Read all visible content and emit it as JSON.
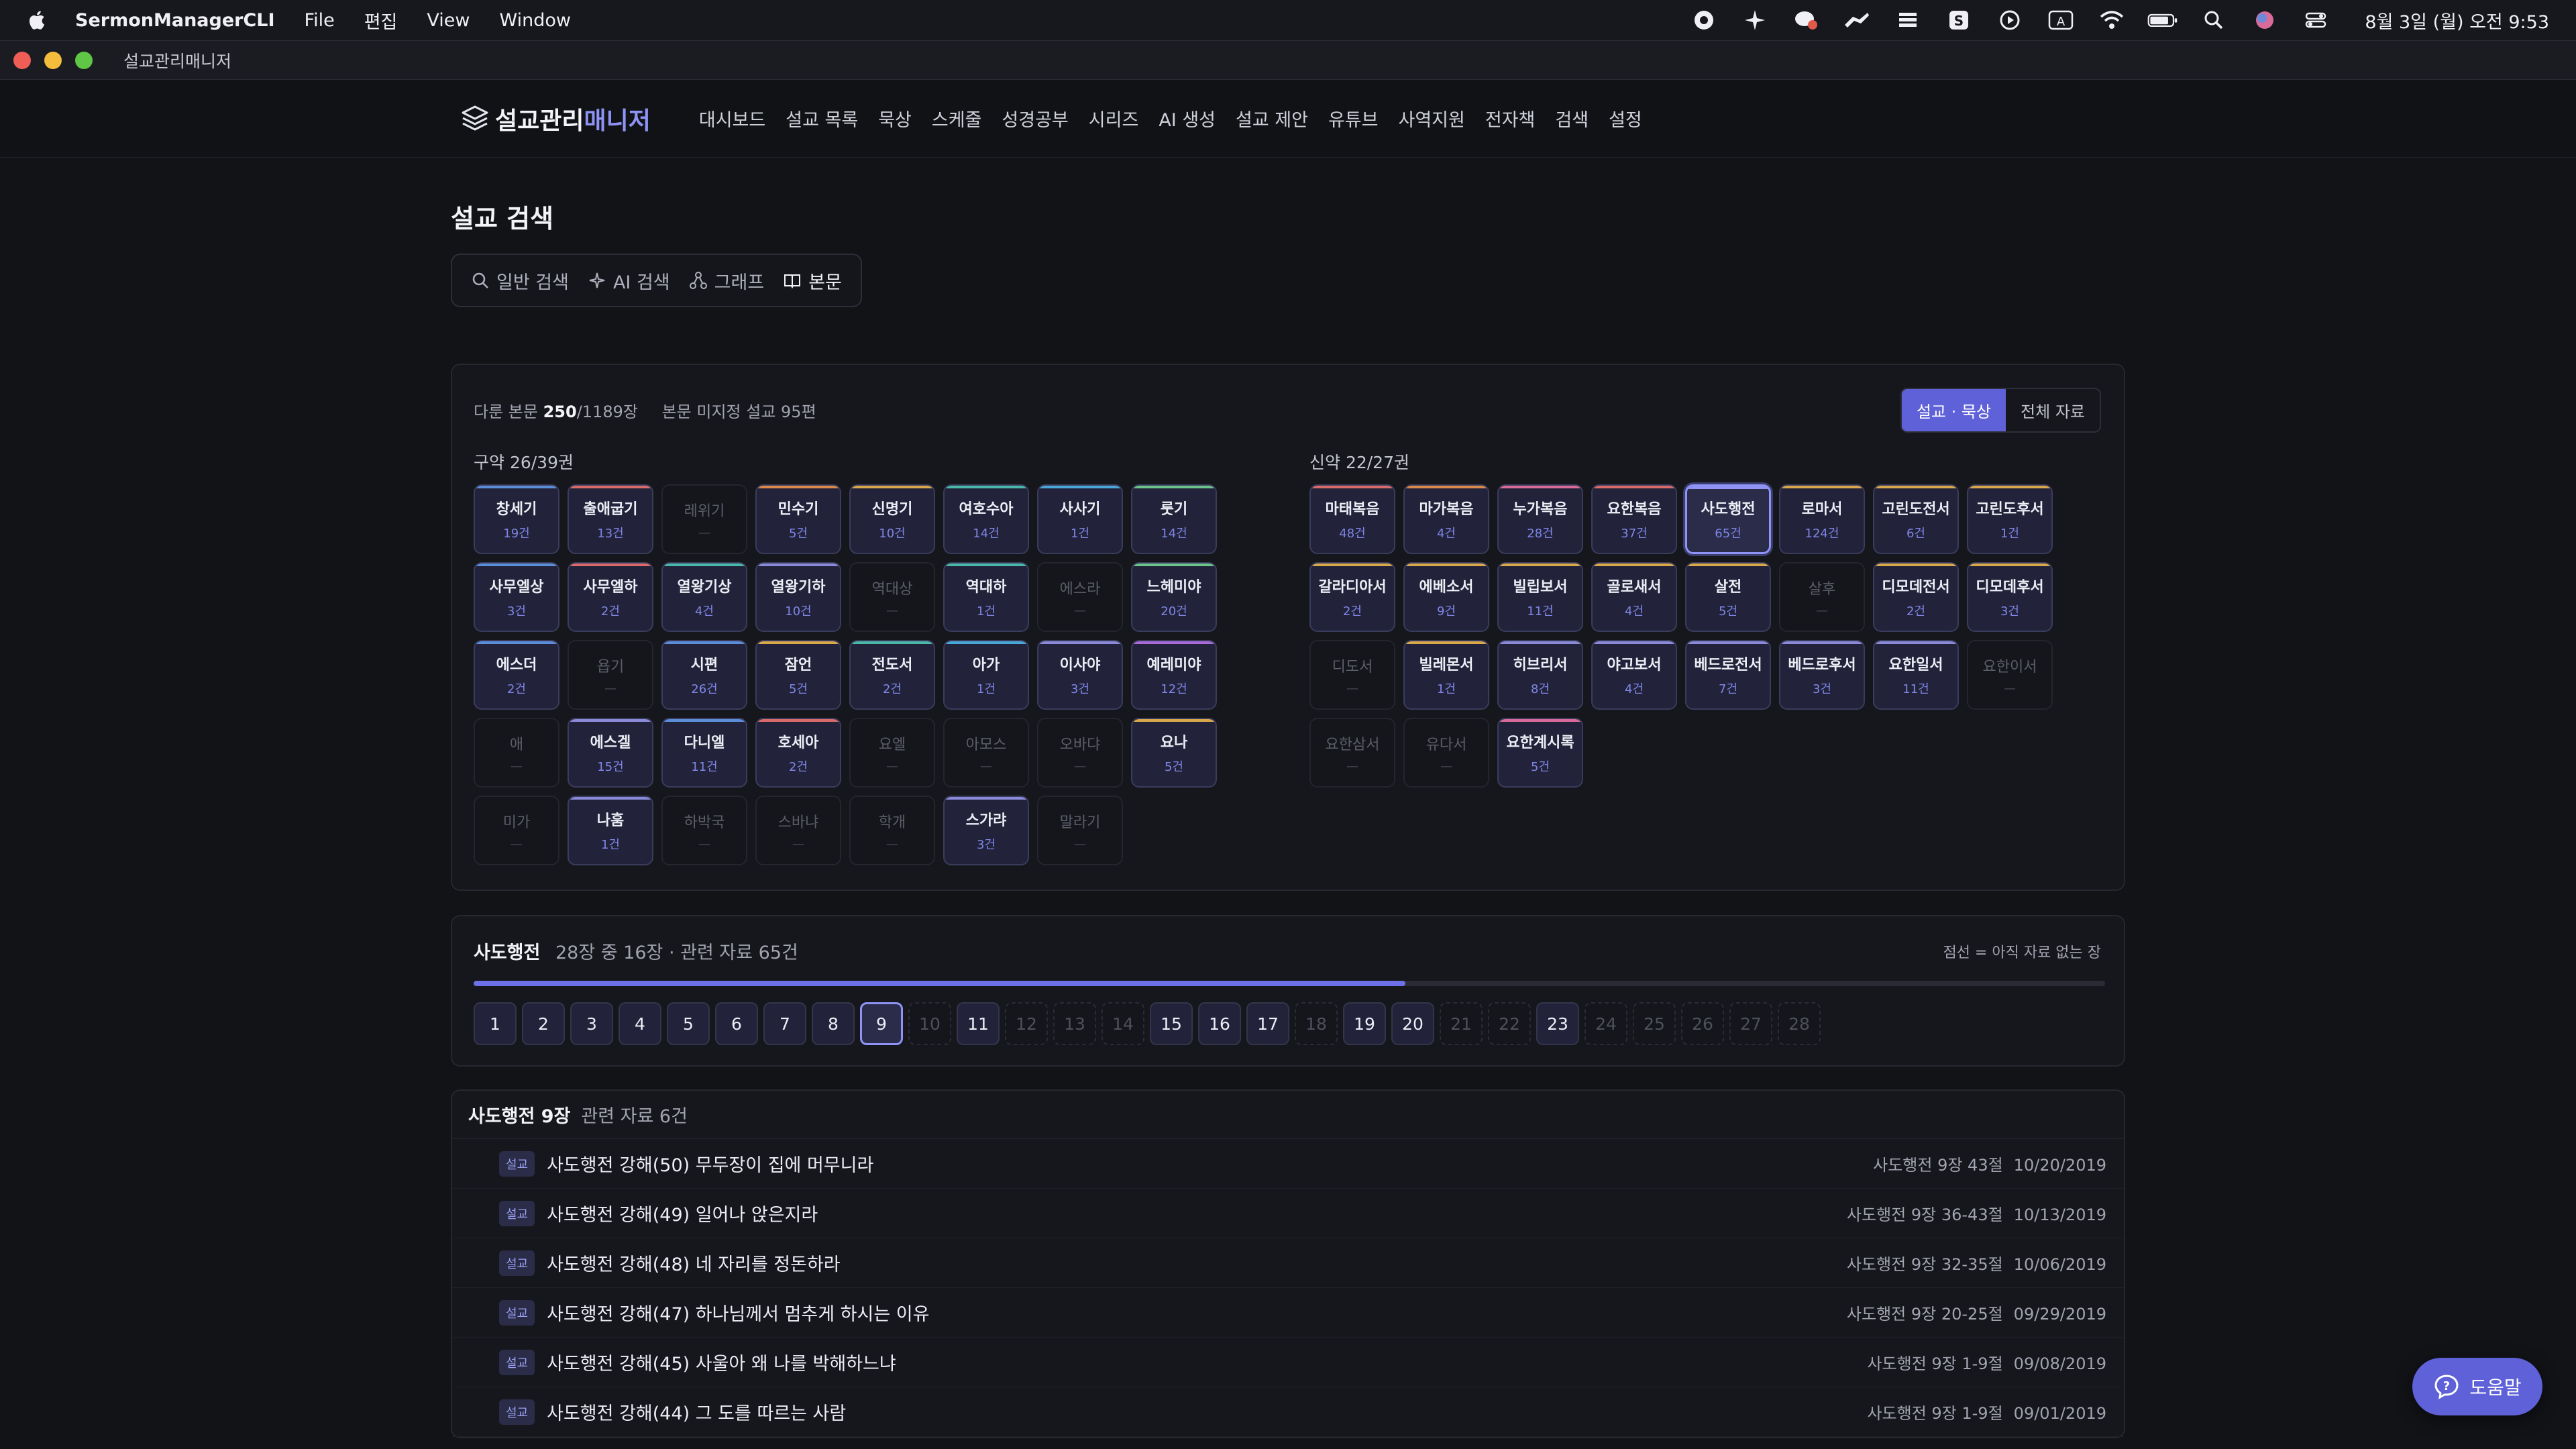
{
  "menubar": {
    "app_name": "SermonManagerCLI",
    "menus": [
      "File",
      "편집",
      "View",
      "Window"
    ],
    "clock": "8월 3일 (월) 오전 9:53"
  },
  "window": {
    "title": "설교관리매니저"
  },
  "nav": {
    "logo_part1": "설교관리",
    "logo_part2": "매니저",
    "items": [
      "대시보드",
      "설교 목록",
      "묵상",
      "스케줄",
      "성경공부",
      "시리즈",
      "AI 생성",
      "설교 제안",
      "유튜브",
      "사역지원",
      "전자책",
      "검색",
      "설정"
    ]
  },
  "page": {
    "title": "설교 검색"
  },
  "tabs": [
    {
      "label": "일반 검색",
      "icon": "search-icon"
    },
    {
      "label": "AI 검색",
      "icon": "sparkle-icon"
    },
    {
      "label": "그래프",
      "icon": "graph-icon"
    },
    {
      "label": "본문",
      "icon": "book-icon",
      "active": true
    }
  ],
  "stats": {
    "covered_label": "다룬 본문",
    "covered_value": "250",
    "covered_total": "/1189장",
    "unassigned": "본문 미지정 설교 95편"
  },
  "scope": {
    "options": [
      "설교 · 묵상",
      "전체 자료"
    ],
    "selected": "설교 · 묵상"
  },
  "ot": {
    "label": "구약 26/39권",
    "books": [
      {
        "name": "창세기",
        "count": "19건",
        "color": "#5b8dd9"
      },
      {
        "name": "출애굽기",
        "count": "13건",
        "color": "#d96b6b"
      },
      {
        "name": "레위기",
        "count": "—"
      },
      {
        "name": "민수기",
        "count": "5건",
        "color": "#d98a4a"
      },
      {
        "name": "신명기",
        "count": "10건",
        "color": "#d9a84a"
      },
      {
        "name": "여호수아",
        "count": "14건",
        "color": "#4ab8a8"
      },
      {
        "name": "사사기",
        "count": "1건",
        "color": "#4aa8d9"
      },
      {
        "name": "룻기",
        "count": "14건",
        "color": "#6bc48a"
      },
      {
        "name": "사무엘상",
        "count": "3건",
        "color": "#5b8dd9"
      },
      {
        "name": "사무엘하",
        "count": "2건",
        "color": "#d96b6b"
      },
      {
        "name": "열왕기상",
        "count": "4건",
        "color": "#4ab8a8"
      },
      {
        "name": "열왕기하",
        "count": "10건",
        "color": "#8a8ad9"
      },
      {
        "name": "역대상",
        "count": "—"
      },
      {
        "name": "역대하",
        "count": "1건",
        "color": "#4ab8a8"
      },
      {
        "name": "에스라",
        "count": "—"
      },
      {
        "name": "느헤미야",
        "count": "20건",
        "color": "#6bc48a"
      },
      {
        "name": "에스더",
        "count": "2건",
        "color": "#5b8dd9"
      },
      {
        "name": "욥기",
        "count": "—"
      },
      {
        "name": "시편",
        "count": "26건",
        "color": "#5b8dd9"
      },
      {
        "name": "잠언",
        "count": "5건",
        "color": "#d9a84a"
      },
      {
        "name": "전도서",
        "count": "2건",
        "color": "#4ab8a8"
      },
      {
        "name": "아가",
        "count": "1건",
        "color": "#4aa8d9"
      },
      {
        "name": "이사야",
        "count": "3건",
        "color": "#8a8ad9"
      },
      {
        "name": "예레미야",
        "count": "12건",
        "color": "#a86bd9"
      },
      {
        "name": "애",
        "count": "—"
      },
      {
        "name": "에스겔",
        "count": "15건",
        "color": "#8a8ad9"
      },
      {
        "name": "다니엘",
        "count": "11건",
        "color": "#5b8dd9"
      },
      {
        "name": "호세아",
        "count": "2건",
        "color": "#d96b6b"
      },
      {
        "name": "요엘",
        "count": "—"
      },
      {
        "name": "아모스",
        "count": "—"
      },
      {
        "name": "오바댜",
        "count": "—"
      },
      {
        "name": "요나",
        "count": "5건",
        "color": "#d9a84a"
      },
      {
        "name": "미가",
        "count": "—"
      },
      {
        "name": "나훔",
        "count": "1건",
        "color": "#8a8ad9"
      },
      {
        "name": "하박국",
        "count": "—"
      },
      {
        "name": "스바냐",
        "count": "—"
      },
      {
        "name": "학개",
        "count": "—"
      },
      {
        "name": "스가랴",
        "count": "3건",
        "color": "#8a8ad9"
      },
      {
        "name": "말라기",
        "count": "—"
      }
    ]
  },
  "nt": {
    "label": "신약 22/27권",
    "books": [
      {
        "name": "마태복음",
        "count": "48건",
        "color": "#d96b6b"
      },
      {
        "name": "마가복음",
        "count": "4건",
        "color": "#d98a4a"
      },
      {
        "name": "누가복음",
        "count": "28건",
        "color": "#d96b9a"
      },
      {
        "name": "요한복음",
        "count": "37건",
        "color": "#d96b6b"
      },
      {
        "name": "사도행전",
        "count": "65건",
        "color": "#8e93f5",
        "selected": true
      },
      {
        "name": "로마서",
        "count": "124건",
        "color": "#d9a84a"
      },
      {
        "name": "고린도전서",
        "count": "6건",
        "color": "#d9a84a"
      },
      {
        "name": "고린도후서",
        "count": "1건",
        "color": "#d9a84a"
      },
      {
        "name": "갈라디아서",
        "count": "2건",
        "color": "#d9a84a"
      },
      {
        "name": "에베소서",
        "count": "9건",
        "color": "#d9a84a"
      },
      {
        "name": "빌립보서",
        "count": "11건",
        "color": "#d9a84a"
      },
      {
        "name": "골로새서",
        "count": "4건",
        "color": "#d9a84a"
      },
      {
        "name": "살전",
        "count": "5건",
        "color": "#d9a84a"
      },
      {
        "name": "살후",
        "count": "—"
      },
      {
        "name": "디모데전서",
        "count": "2건",
        "color": "#d9a84a"
      },
      {
        "name": "디모데후서",
        "count": "3건",
        "color": "#d9a84a"
      },
      {
        "name": "디도서",
        "count": "—"
      },
      {
        "name": "빌레몬서",
        "count": "1건",
        "color": "#d9a84a"
      },
      {
        "name": "히브리서",
        "count": "8건",
        "color": "#8a8ad9"
      },
      {
        "name": "야고보서",
        "count": "4건",
        "color": "#8a8ad9"
      },
      {
        "name": "베드로전서",
        "count": "7건",
        "color": "#8a8ad9"
      },
      {
        "name": "베드로후서",
        "count": "3건",
        "color": "#8a8ad9"
      },
      {
        "name": "요한일서",
        "count": "11건",
        "color": "#8a8ad9"
      },
      {
        "name": "요한이서",
        "count": "—"
      },
      {
        "name": "요한삼서",
        "count": "—"
      },
      {
        "name": "유다서",
        "count": "—"
      },
      {
        "name": "요한계시록",
        "count": "5건",
        "color": "#d96b9a"
      }
    ]
  },
  "chapters": {
    "book": "사도행전",
    "summary": "28장 중 16장 · 관련 자료 65건",
    "legend": "점선 = 아직 자료 없는 장",
    "progress": 0.571,
    "items": [
      {
        "n": "1",
        "has": true
      },
      {
        "n": "2",
        "has": true
      },
      {
        "n": "3",
        "has": true
      },
      {
        "n": "4",
        "has": true
      },
      {
        "n": "5",
        "has": true
      },
      {
        "n": "6",
        "has": true
      },
      {
        "n": "7",
        "has": true
      },
      {
        "n": "8",
        "has": true
      },
      {
        "n": "9",
        "has": true,
        "selected": true
      },
      {
        "n": "10",
        "has": false
      },
      {
        "n": "11",
        "has": true
      },
      {
        "n": "12",
        "has": false
      },
      {
        "n": "13",
        "has": false
      },
      {
        "n": "14",
        "has": false
      },
      {
        "n": "15",
        "has": true
      },
      {
        "n": "16",
        "has": true
      },
      {
        "n": "17",
        "has": true
      },
      {
        "n": "18",
        "has": false
      },
      {
        "n": "19",
        "has": true
      },
      {
        "n": "20",
        "has": true
      },
      {
        "n": "21",
        "has": false
      },
      {
        "n": "22",
        "has": false
      },
      {
        "n": "23",
        "has": true
      },
      {
        "n": "24",
        "has": false
      },
      {
        "n": "25",
        "has": false
      },
      {
        "n": "26",
        "has": false
      },
      {
        "n": "27",
        "has": false
      },
      {
        "n": "28",
        "has": false
      }
    ]
  },
  "results": {
    "heading": "사도행전 9장",
    "count": "관련 자료 6건",
    "rows": [
      {
        "tag": "설교",
        "title": "사도행전 강해(50) 무두장이 집에 머무니라",
        "ref": "사도행전 9장 43절",
        "date": "10/20/2019"
      },
      {
        "tag": "설교",
        "title": "사도행전 강해(49) 일어나 앉은지라",
        "ref": "사도행전 9장 36-43절",
        "date": "10/13/2019"
      },
      {
        "tag": "설교",
        "title": "사도행전 강해(48) 네 자리를 정돈하라",
        "ref": "사도행전 9장 32-35절",
        "date": "10/06/2019"
      },
      {
        "tag": "설교",
        "title": "사도행전 강해(47) 하나님께서 멈추게 하시는 이유",
        "ref": "사도행전 9장 20-25절",
        "date": "09/29/2019"
      },
      {
        "tag": "설교",
        "title": "사도행전 강해(45) 사울아 왜 나를 박해하느냐",
        "ref": "사도행전 9장 1-9절",
        "date": "09/08/2019"
      },
      {
        "tag": "설교",
        "title": "사도행전 강해(44) 그 도를 따르는 사람",
        "ref": "사도행전 9장 1-9절",
        "date": "09/01/2019"
      }
    ]
  },
  "help": {
    "label": "도움말"
  }
}
